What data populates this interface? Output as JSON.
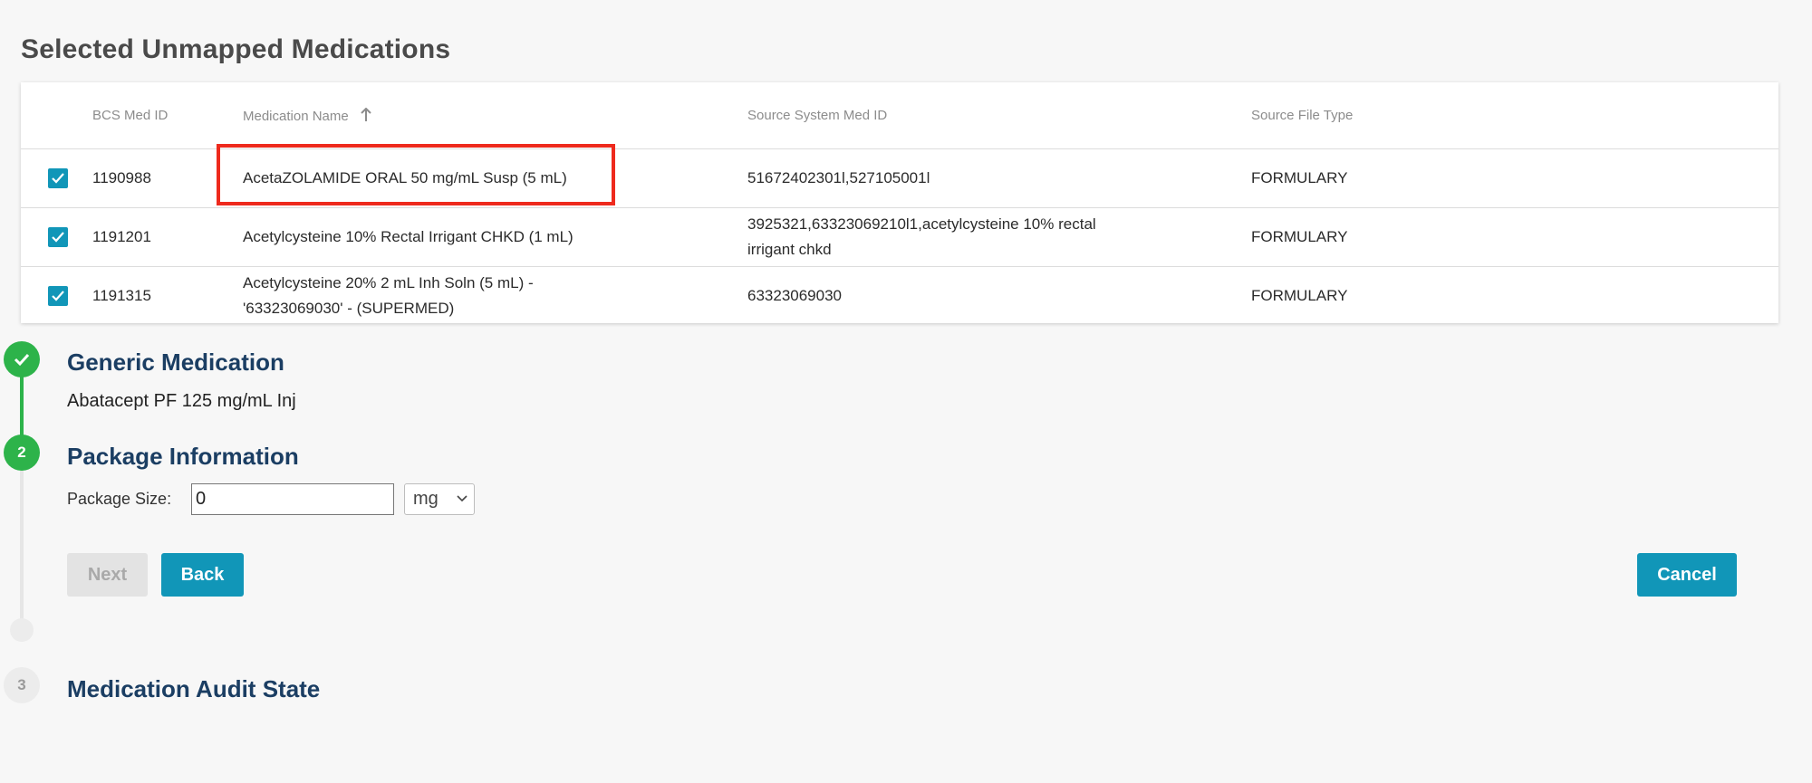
{
  "page_title": "Selected Unmapped Medications",
  "table": {
    "columns": [
      "BCS Med ID",
      "Medication Name",
      "Source System Med ID",
      "Source File Type"
    ],
    "sort_column": "Medication Name",
    "sort_direction": "ascending",
    "rows": [
      {
        "checked": true,
        "bcs_med_id": "1190988",
        "name_lines": [
          "AcetaZOLAMIDE ORAL 50 mg/mL Susp (5 mL)"
        ],
        "source_lines": [
          "51672402301l,527105001l"
        ],
        "file_type": "FORMULARY",
        "highlighted": true
      },
      {
        "checked": true,
        "bcs_med_id": "1191201",
        "name_lines": [
          "Acetylcysteine 10% Rectal Irrigant CHKD (1 mL)"
        ],
        "source_lines": [
          "3925321,63323069210l1,acetylcysteine 10% rectal",
          "irrigant chkd"
        ],
        "file_type": "FORMULARY",
        "highlighted": false
      },
      {
        "checked": true,
        "bcs_med_id": "1191315",
        "name_lines": [
          "Acetylcysteine 20% 2 mL Inh Soln (5 mL) -",
          "'63323069030' - (SUPERMED)"
        ],
        "source_lines": [
          "63323069030"
        ],
        "file_type": "FORMULARY",
        "highlighted": false
      }
    ]
  },
  "steps": [
    {
      "status": "completed",
      "number": "",
      "title": "Generic Medication",
      "value": "Abatacept PF 125 mg/mL Inj"
    },
    {
      "status": "active",
      "number": "2",
      "title": "Package Information"
    },
    {
      "status": "pending",
      "number": "3",
      "title": "Medication Audit State"
    }
  ],
  "package": {
    "label": "Package Size:",
    "size_value": "0",
    "unit_selected": "mg"
  },
  "buttons": {
    "next": "Next",
    "back": "Back",
    "cancel": "Cancel"
  },
  "colors": {
    "accent": "#1196b8",
    "success": "#2db34a",
    "highlight": "#ee2a1d",
    "heading": "#1b3e63"
  },
  "icons": {
    "checkbox": "checkmark-icon",
    "sort": "arrow-up-icon",
    "step_complete": "check-icon",
    "select": "chevron-down-icon"
  }
}
